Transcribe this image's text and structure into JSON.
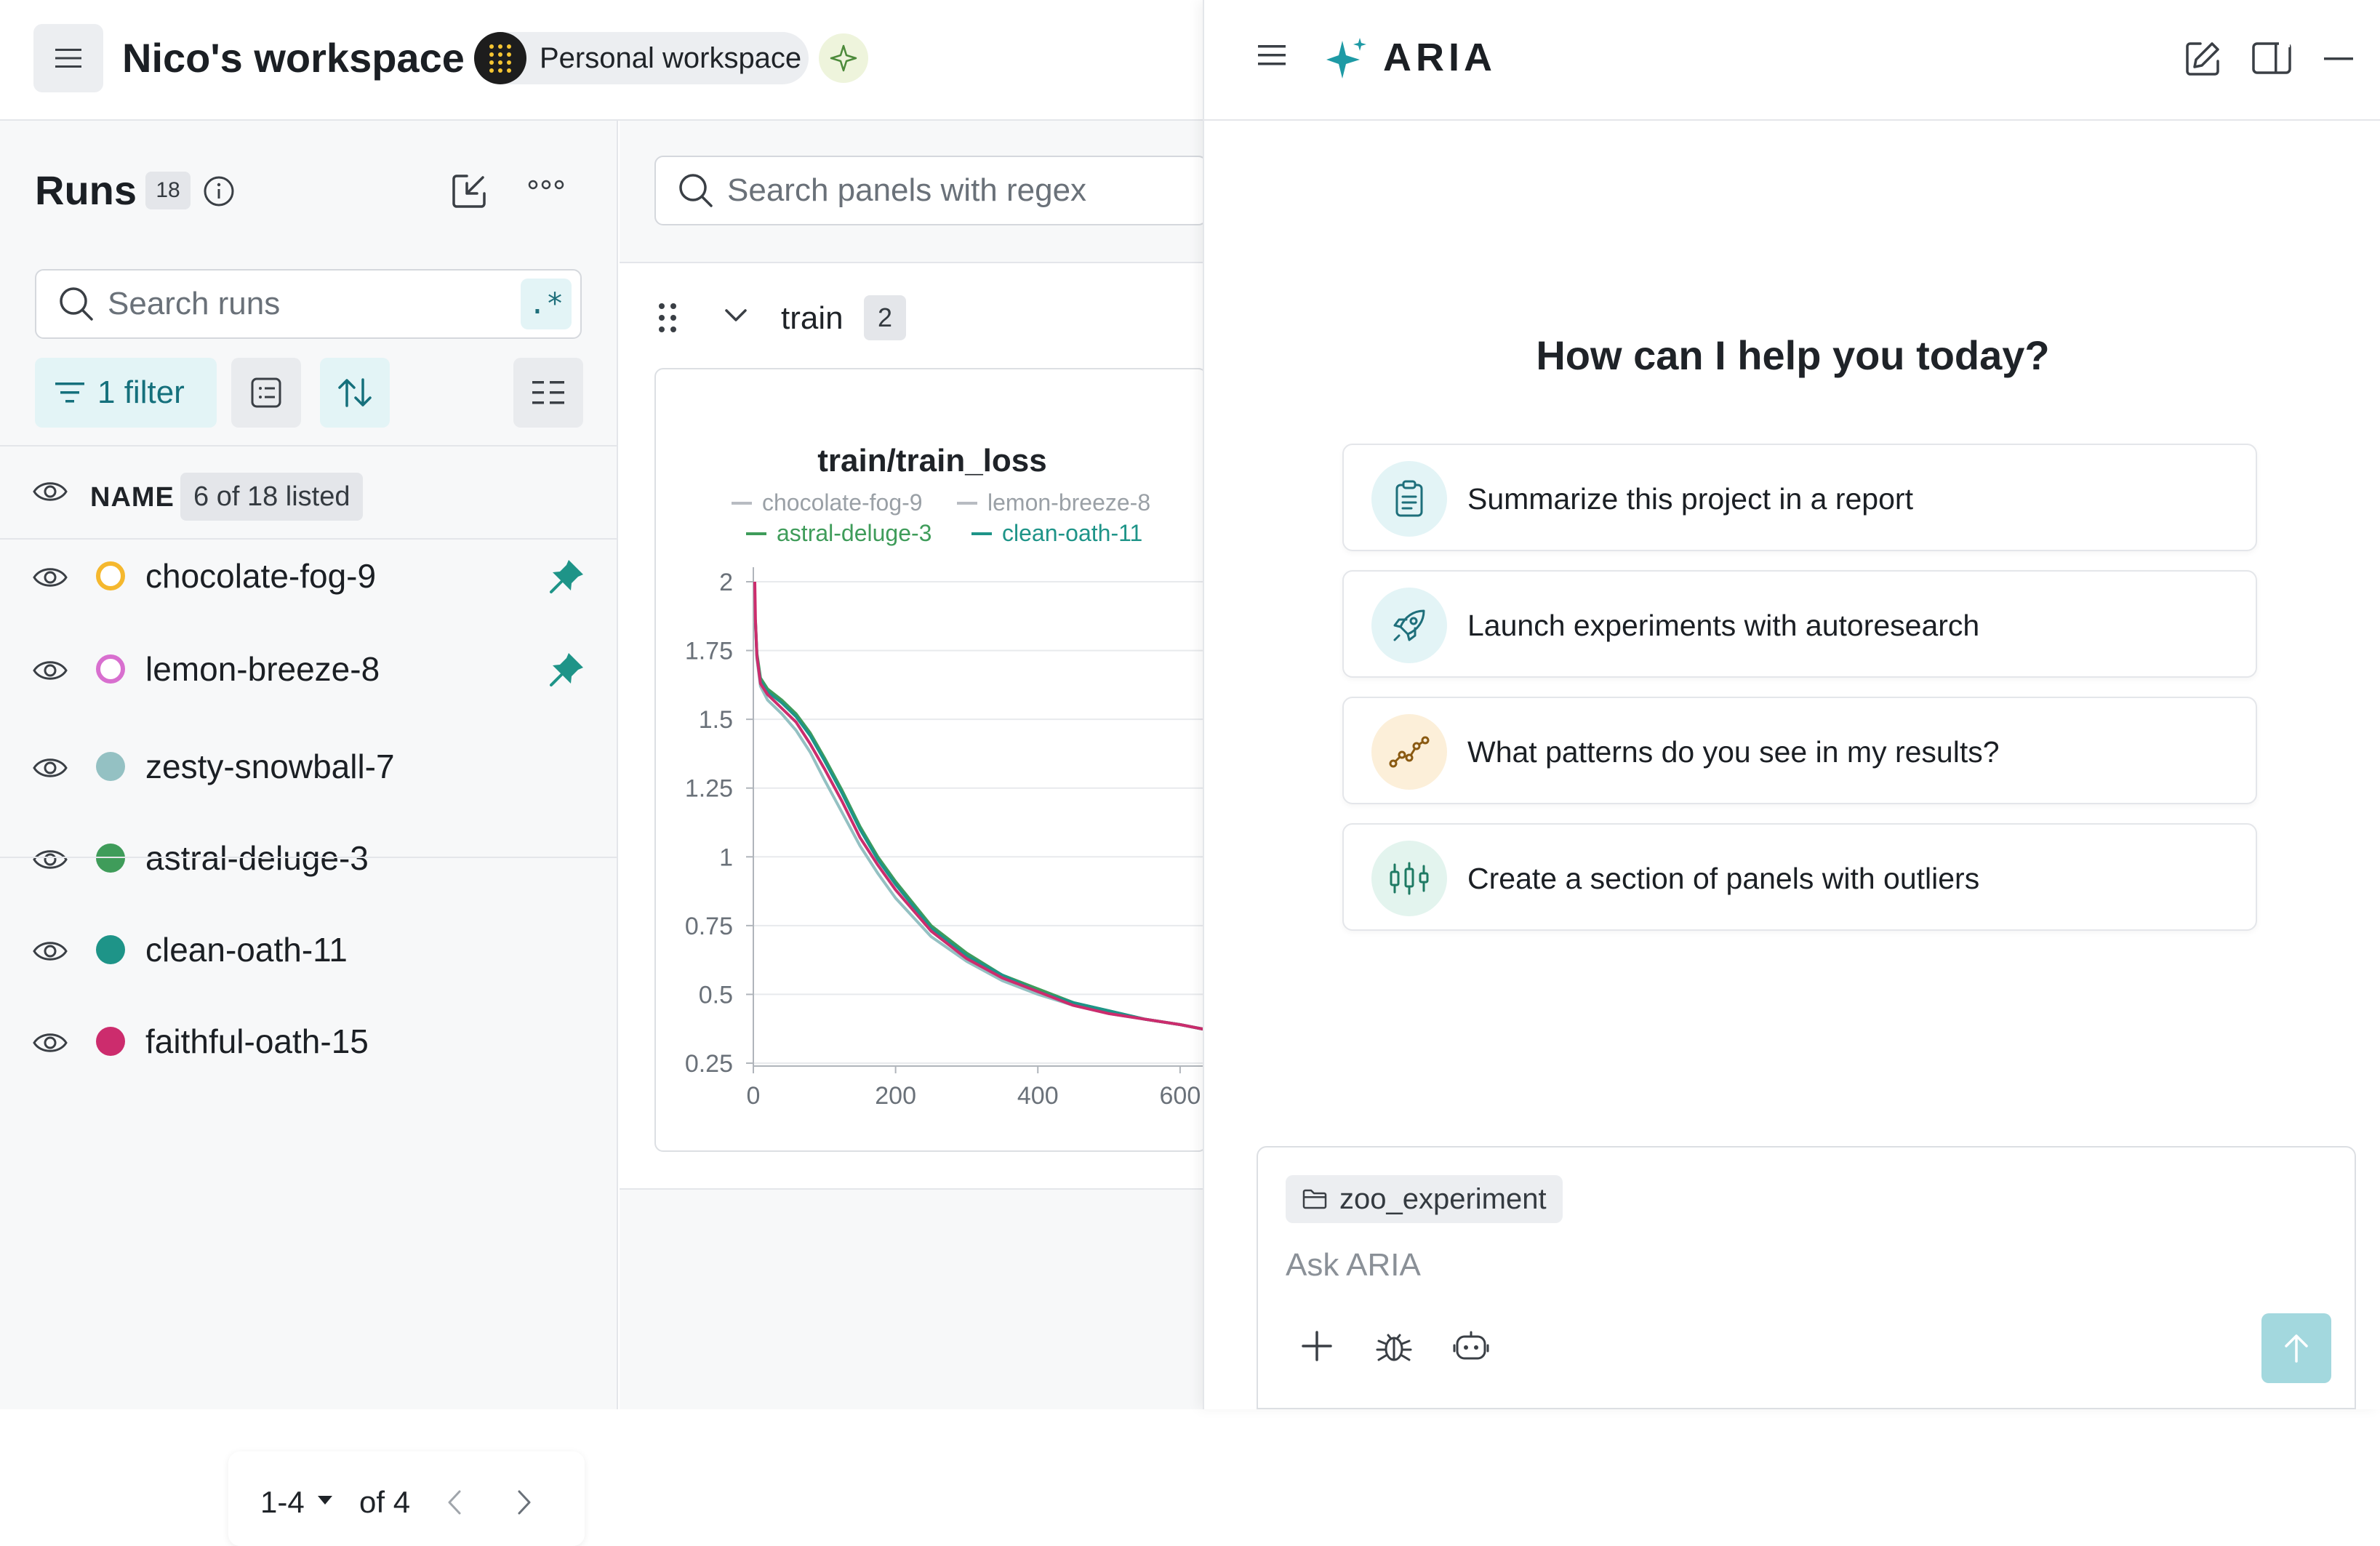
{
  "workspace": {
    "title": "Nico's workspace",
    "pill_label": "Personal workspace"
  },
  "runs": {
    "title": "Runs",
    "count": "18",
    "search_placeholder": "Search runs",
    "regex_label": ".*",
    "filter_label": "1 filter",
    "name_header": "NAME",
    "listed_label": "6 of 18 listed",
    "items": [
      {
        "name": "chocolate-fog-9",
        "color": "#f5b82e",
        "style": "ring",
        "pinned": true
      },
      {
        "name": "lemon-breeze-8",
        "color": "#d86fcf",
        "style": "ring",
        "pinned": true
      },
      {
        "name": "zesty-snowball-7",
        "color": "#94c1c3",
        "style": "solid",
        "pinned": false
      },
      {
        "name": "astral-deluge-3",
        "color": "#3f9c5a",
        "style": "solid",
        "pinned": false
      },
      {
        "name": "clean-oath-11",
        "color": "#1e9488",
        "style": "solid",
        "pinned": false
      },
      {
        "name": "faithful-oath-15",
        "color": "#cc2c6d",
        "style": "solid",
        "pinned": false
      }
    ],
    "pager": {
      "range": "1-4",
      "of": "of 4"
    }
  },
  "panels": {
    "search_placeholder": "Search panels with regex",
    "section_name": "train",
    "section_count": "2"
  },
  "chart_data": {
    "type": "line",
    "title": "train/train_loss",
    "xlabel": "",
    "ylabel": "",
    "xlim": [
      0,
      640
    ],
    "ylim": [
      0.25,
      2
    ],
    "x_ticks": [
      "0",
      "200",
      "400",
      "600"
    ],
    "y_ticks": [
      "0.25",
      "0.5",
      "0.75",
      "1",
      "1.25",
      "1.5",
      "1.75",
      "2"
    ],
    "legend": [
      {
        "name": "chocolate-fog-9",
        "color": "#b8bcc2"
      },
      {
        "name": "lemon-breeze-8",
        "color": "#b8bcc2"
      },
      {
        "name": "astral-deluge-3",
        "color": "#3f9c5a"
      },
      {
        "name": "clean-oath-11",
        "color": "#1e9488"
      }
    ],
    "series": [
      {
        "name": "zesty-snowball-7",
        "color": "#94c1c3",
        "x": [
          3,
          5,
          10,
          20,
          40,
          60,
          80,
          100,
          125,
          150,
          175,
          200,
          250,
          300,
          350,
          400,
          450,
          500,
          550,
          600,
          640
        ],
        "y": [
          1.85,
          1.72,
          1.62,
          1.57,
          1.52,
          1.46,
          1.38,
          1.28,
          1.16,
          1.04,
          0.94,
          0.85,
          0.71,
          0.62,
          0.55,
          0.5,
          0.46,
          0.43,
          0.41,
          0.39,
          0.37
        ]
      },
      {
        "name": "astral-deluge-3",
        "color": "#3f9c5a",
        "x": [
          3,
          5,
          10,
          20,
          40,
          60,
          80,
          100,
          125,
          150,
          175,
          200,
          250,
          300,
          350,
          400,
          450,
          500,
          550,
          600,
          640
        ],
        "y": [
          1.86,
          1.74,
          1.65,
          1.61,
          1.57,
          1.52,
          1.45,
          1.36,
          1.24,
          1.11,
          1.0,
          0.91,
          0.75,
          0.65,
          0.57,
          0.52,
          0.47,
          0.44,
          0.41,
          0.39,
          0.37
        ]
      },
      {
        "name": "clean-oath-11",
        "color": "#1e9488",
        "x": [
          3,
          5,
          10,
          20,
          40,
          60,
          80,
          100,
          125,
          150,
          175,
          200,
          250,
          300,
          350,
          400,
          450,
          500,
          550,
          600,
          640
        ],
        "y": [
          1.85,
          1.73,
          1.64,
          1.6,
          1.56,
          1.51,
          1.44,
          1.35,
          1.23,
          1.1,
          0.99,
          0.9,
          0.74,
          0.64,
          0.57,
          0.51,
          0.47,
          0.44,
          0.41,
          0.39,
          0.37
        ]
      },
      {
        "name": "faithful-oath-15",
        "color": "#cc2c6d",
        "x": [
          2,
          3,
          5,
          10,
          20,
          40,
          60,
          80,
          100,
          125,
          150,
          175,
          200,
          250,
          300,
          350,
          400,
          450,
          500,
          550,
          600,
          640
        ],
        "y": [
          2.0,
          1.86,
          1.73,
          1.63,
          1.59,
          1.54,
          1.49,
          1.41,
          1.32,
          1.2,
          1.07,
          0.97,
          0.88,
          0.73,
          0.63,
          0.56,
          0.51,
          0.46,
          0.43,
          0.41,
          0.39,
          0.37
        ]
      }
    ]
  },
  "aria": {
    "title": "ARIA",
    "greeting": "How can I help you today?",
    "suggestions": [
      {
        "label": "Summarize this project in a report",
        "icon": "report-icon",
        "bg": "#e3f4f6"
      },
      {
        "label": "Launch experiments with autoresearch",
        "icon": "rocket-icon",
        "bg": "#e3f4f6"
      },
      {
        "label": "What patterns do you see in my results?",
        "icon": "pattern-icon",
        "bg": "#fcefd9"
      },
      {
        "label": "Create a section of panels with outliers",
        "icon": "candlestick-icon",
        "bg": "#e3f4ee"
      }
    ],
    "context_chip": "zoo_experiment",
    "input_placeholder": "Ask ARIA"
  }
}
